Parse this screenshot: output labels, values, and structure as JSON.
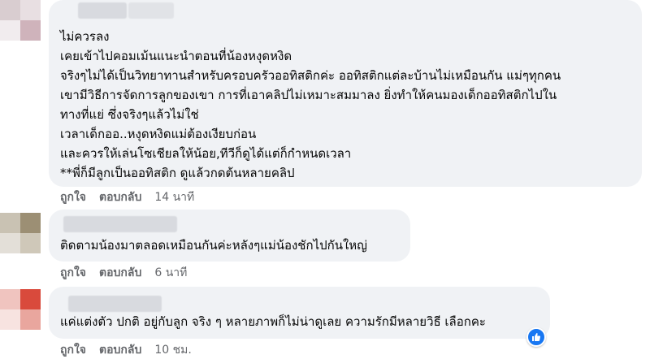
{
  "comments": [
    {
      "text": "ไม่ควรลง\nเคยเข้าไปคอมเม้นแนะนำตอนที่น้องหงุดหงิด\nจริงๆไม่ได้เป็นวิทยาทานสำหรับครอบครัวออทิสติกค่ะ ออทิสติกแต่ละบ้านไม่เหมือนกัน แม่ๆทุกคน\nเขามีวิธีการจัดการลูกของเขา การที่เอาคลิปไม่เหมาะสมมาลง ยิ่งทำให้คนมองเด็กออทิสติกไปใน\nทางที่แย่ ซึ่งจริงๆแล้วไม่ใช่\nเวลาเด็กออ..หงุดหงิดแม่ต้องเงียบก่อน\nและควรให้เล่นโซเชียลให้น้อย,ทีวีก็ดูได้แต่ก็กำหนดเวลา\n**พี่ก็มีลูกเป็นออทิสติก ดูแล้วกดต้นหลายคลิป",
      "like_label": "ถูกใจ",
      "reply_label": "ตอบกลับ",
      "time": "14 นาที"
    },
    {
      "text": "ติดตามน้องมาตลอดเหมือนกันค่ะหลังๆแม่น้องชักไปกันใหญ่",
      "like_label": "ถูกใจ",
      "reply_label": "ตอบกลับ",
      "time": "6 นาที"
    },
    {
      "text": "แค่แต่งตัว ปกติ อยู่กับลูก จริง ๆ หลายภาพก็ไม่น่าดูเลย ความรักมีหลายวิธี เลือกคะ",
      "like_label": "ถูกใจ",
      "reply_label": "ตอบกลับ",
      "time": "10 ชม."
    }
  ],
  "icons": {
    "like_reaction": "thumbs-up-icon"
  },
  "colors": {
    "bubble": "#f0f2f5",
    "meta_text": "#65676b",
    "like_blue": "#1877f2"
  }
}
